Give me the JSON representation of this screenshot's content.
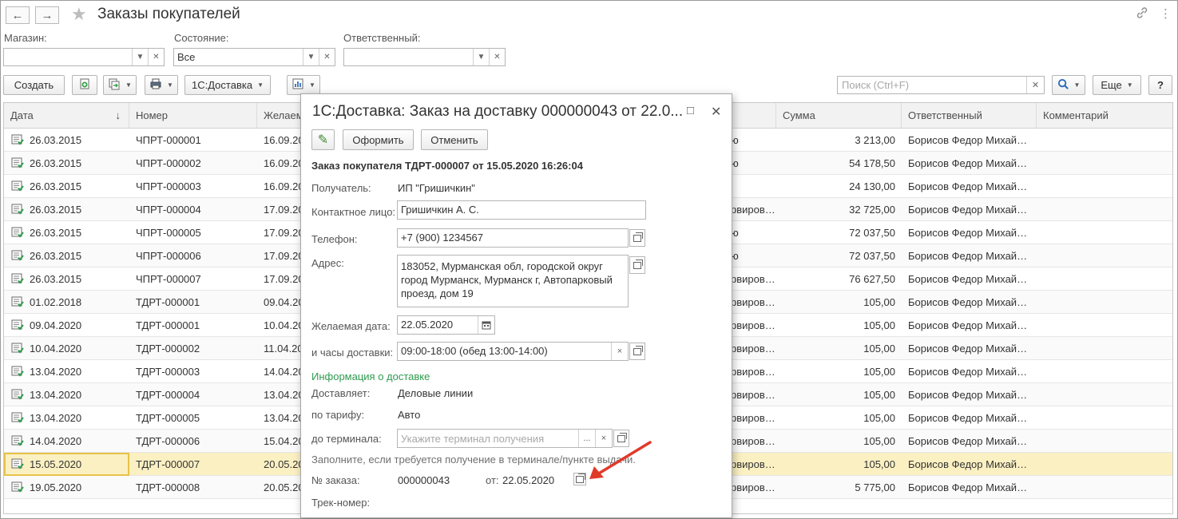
{
  "window": {
    "title": "Заказы покупателей",
    "nav_back": "←",
    "nav_forward": "→",
    "star": "★",
    "link_icon": "🔗",
    "more_icon": "⋮"
  },
  "filters": {
    "shop_label": "Магазин:",
    "shop_value": "",
    "state_label": "Состояние:",
    "state_value": "Все",
    "responsible_label": "Ответственный:",
    "responsible_value": ""
  },
  "toolbar": {
    "create": "Создать",
    "delivery": "1С:Доставка",
    "search_placeholder": "Поиск (Ctrl+F)",
    "more": "Еще",
    "help": "?"
  },
  "table": {
    "columns": {
      "date": "Дата",
      "sort": "↓",
      "number": "Номер",
      "desired": "Желаем",
      "sum": "Сумма",
      "responsible": "Ответственный",
      "comment": "Комментарий"
    },
    "rows": [
      {
        "date": "26.03.2015",
        "number": "ЧПРТ-000001",
        "desired": "16.09.20",
        "state": "ю",
        "sum": "3 213,00",
        "responsible": "Борисов Федор Михай…"
      },
      {
        "date": "26.03.2015",
        "number": "ЧПРТ-000002",
        "desired": "16.09.20",
        "state": "ю",
        "sum": "54 178,50",
        "responsible": "Борисов Федор Михай…"
      },
      {
        "date": "26.03.2015",
        "number": "ЧПРТ-000003",
        "desired": "16.09.20",
        "state": "",
        "sum": "24 130,00",
        "responsible": "Борисов Федор Михай…"
      },
      {
        "date": "26.03.2015",
        "number": "ЧПРТ-000004",
        "desired": "17.09.20",
        "state": "рвиров…",
        "sum": "32 725,00",
        "responsible": "Борисов Федор Михай…"
      },
      {
        "date": "26.03.2015",
        "number": "ЧПРТ-000005",
        "desired": "17.09.20",
        "state": "ю",
        "sum": "72 037,50",
        "responsible": "Борисов Федор Михай…"
      },
      {
        "date": "26.03.2015",
        "number": "ЧПРТ-000006",
        "desired": "17.09.20",
        "state": "ю",
        "sum": "72 037,50",
        "responsible": "Борисов Федор Михай…"
      },
      {
        "date": "26.03.2015",
        "number": "ЧПРТ-000007",
        "desired": "17.09.20",
        "state": "рвиров…",
        "sum": "76 627,50",
        "responsible": "Борисов Федор Михай…"
      },
      {
        "date": "01.02.2018",
        "number": "ТДРТ-000001",
        "desired": "09.04.20",
        "state": "рвиров…",
        "sum": "105,00",
        "responsible": "Борисов Федор Михай…"
      },
      {
        "date": "09.04.2020",
        "number": "ТДРТ-000001",
        "desired": "10.04.20",
        "state": "рвиров…",
        "sum": "105,00",
        "responsible": "Борисов Федор Михай…"
      },
      {
        "date": "10.04.2020",
        "number": "ТДРТ-000002",
        "desired": "11.04.20",
        "state": "рвиров…",
        "sum": "105,00",
        "responsible": "Борисов Федор Михай…"
      },
      {
        "date": "13.04.2020",
        "number": "ТДРТ-000003",
        "desired": "14.04.20",
        "state": "рвиров…",
        "sum": "105,00",
        "responsible": "Борисов Федор Михай…"
      },
      {
        "date": "13.04.2020",
        "number": "ТДРТ-000004",
        "desired": "13.04.20",
        "state": "рвиров…",
        "sum": "105,00",
        "responsible": "Борисов Федор Михай…"
      },
      {
        "date": "13.04.2020",
        "number": "ТДРТ-000005",
        "desired": "13.04.20",
        "state": "рвиров…",
        "sum": "105,00",
        "responsible": "Борисов Федор Михай…"
      },
      {
        "date": "14.04.2020",
        "number": "ТДРТ-000006",
        "desired": "15.04.20",
        "state": "рвиров…",
        "sum": "105,00",
        "responsible": "Борисов Федор Михай…"
      },
      {
        "date": "15.05.2020",
        "number": "ТДРТ-000007",
        "desired": "20.05.20",
        "state": "рвиров…",
        "sum": "105,00",
        "responsible": "Борисов Федор Михай…"
      },
      {
        "date": "19.05.2020",
        "number": "ТДРТ-000008",
        "desired": "20.05.20",
        "state": "рвиров…",
        "sum": "5 775,00",
        "responsible": "Борисов Федор Михай…"
      }
    ]
  },
  "dialog": {
    "title": "1С:Доставка: Заказ на доставку 000000043 от 22.0...",
    "maximize": "□",
    "close": "✕",
    "edit_icon": "✎",
    "issue": "Оформить",
    "cancel": "Отменить",
    "header": "Заказ покупателя ТДРТ-000007 от 15.05.2020 16:26:04",
    "recipient_label": "Получатель:",
    "recipient": "ИП \"Гришичкин\"",
    "contact_label": "Контактное лицо:",
    "contact": "Гришичкин А. С.",
    "phone_label": "Телефон:",
    "phone": "+7 (900) 1234567",
    "address_label": "Адрес:",
    "address_lines": [
      "183052, Мурманская обл, городской округ",
      "город Мурманск, Мурманск г, Автопарковый",
      "проезд, дом 19"
    ],
    "date_label": "Желаемая дата:",
    "date": "22.05.2020",
    "hours_label": "и часы доставки:",
    "hours": "09:00-18:00 (обед 13:00-14:00)",
    "info_header": "Информация о доставке",
    "carrier_label": "Доставляет:",
    "carrier": "Деловые линии",
    "tariff_label": "по тарифу:",
    "tariff": "Авто",
    "terminal_label": "до терминала:",
    "terminal_placeholder": "Укажите терминал получения",
    "terminal_hint": "Заполните, если требуется получение в терминале/пункте выдачи.",
    "order_label": "№ заказа:",
    "order": "000000043",
    "from_label": "от:",
    "from": "22.05.2020",
    "track_label": "Трек-номер:",
    "ellipsis": "...",
    "clear": "×"
  },
  "colors": {
    "accent_green": "#2f9b4f",
    "selected_row": "#fbf0c2",
    "arrow": "#e03a2a"
  }
}
